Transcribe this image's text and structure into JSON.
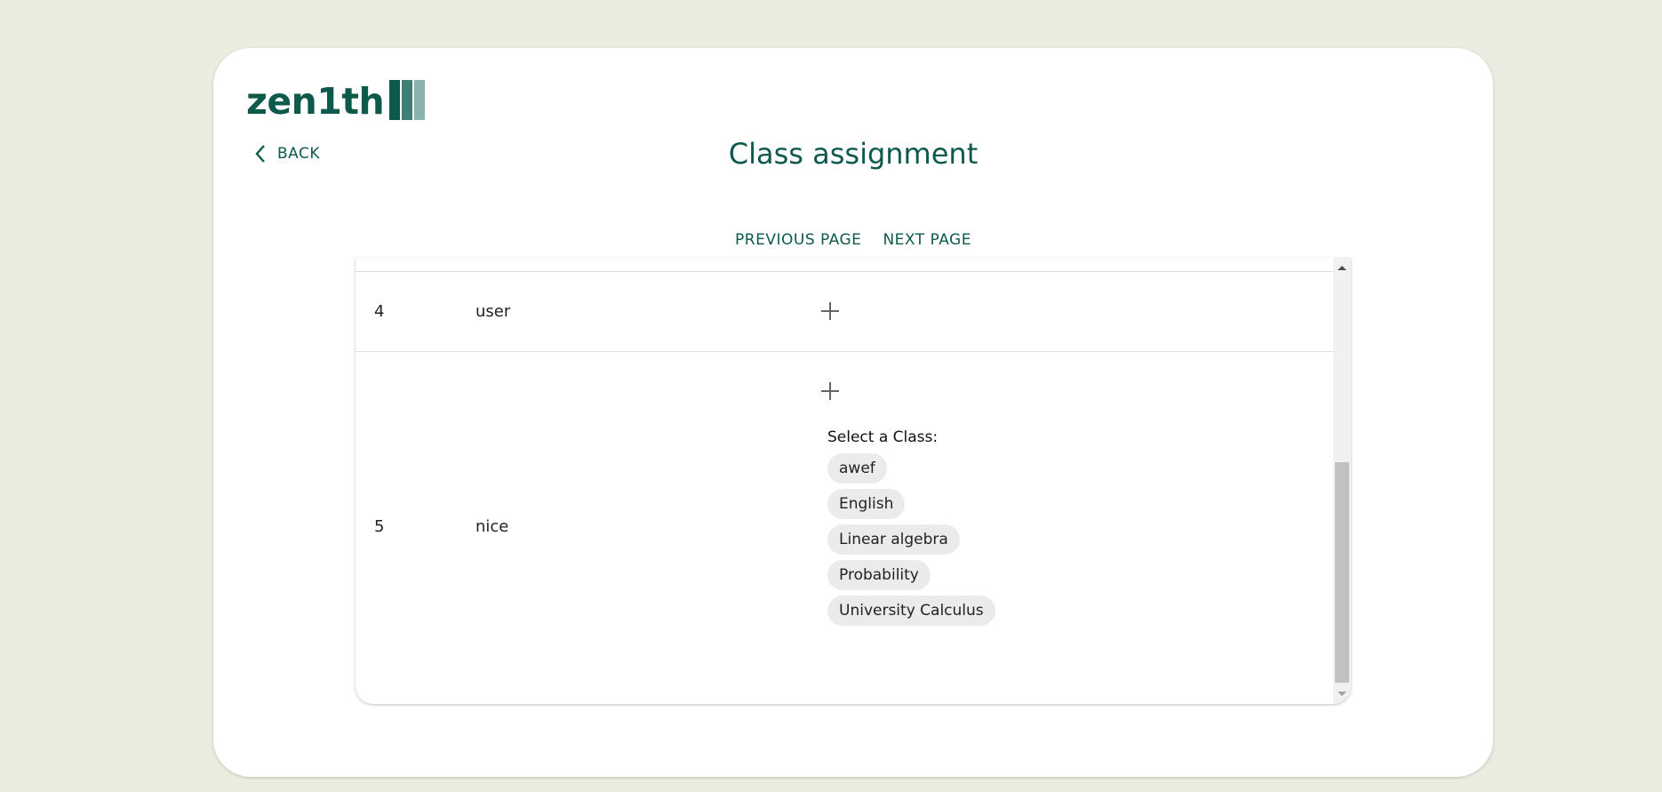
{
  "brand": {
    "logo_text": "zen1th"
  },
  "nav": {
    "back_label": "BACK"
  },
  "page": {
    "title": "Class assignment"
  },
  "pagination": {
    "previous_label": "PREVIOUS PAGE",
    "next_label": "NEXT PAGE"
  },
  "rows": [
    {
      "id": "4",
      "name": "user"
    },
    {
      "id": "5",
      "name": "nice"
    }
  ],
  "class_picker": {
    "label": "Select a Class:",
    "options": [
      "awef",
      "English",
      "Linear algebra",
      "Probability",
      "University Calculus"
    ]
  },
  "colors": {
    "brand": "#0d5a4c",
    "background": "#ebebdf",
    "chip": "#ebebeb"
  }
}
